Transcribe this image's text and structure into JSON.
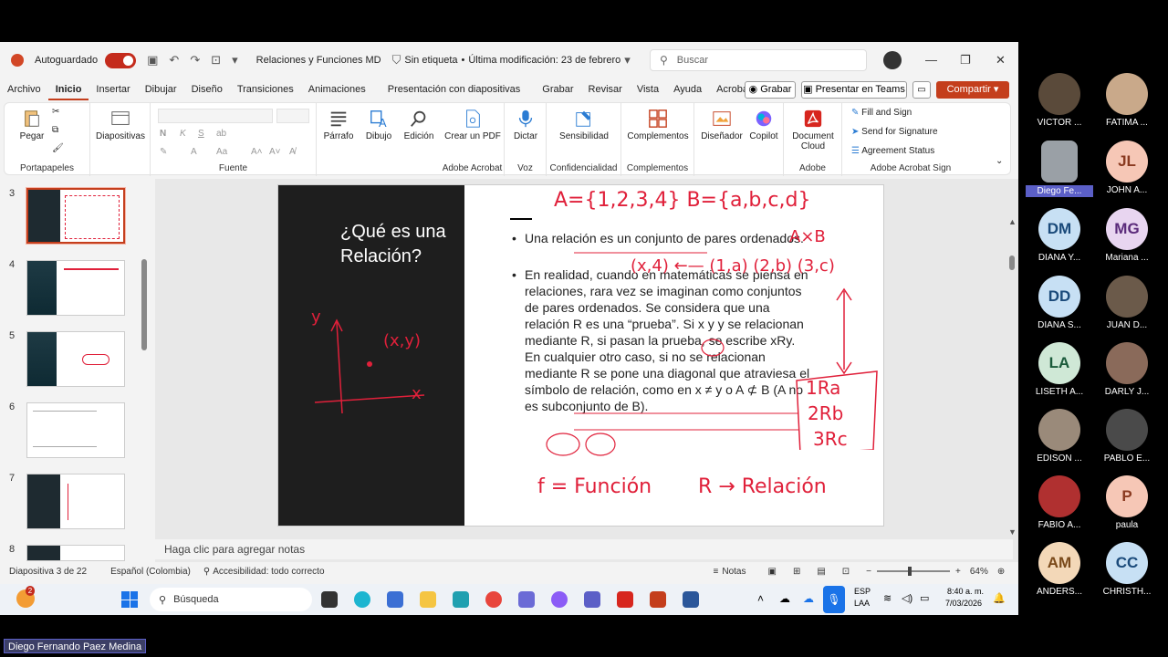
{
  "titlebar": {
    "autosave_label": "Autoguardado",
    "file_name": "Relaciones y Funciones MD",
    "label_status": "Sin etiqueta",
    "modified": "Última modificación: 23 de febrero",
    "search_placeholder": "Buscar"
  },
  "tabs": [
    "Archivo",
    "Inicio",
    "Insertar",
    "Dibujar",
    "Diseño",
    "Transiciones",
    "Animaciones",
    "Presentación con diapositivas",
    "Grabar",
    "Revisar",
    "Vista",
    "Ayuda",
    "Acrobat"
  ],
  "actions": {
    "grabar": "Grabar",
    "teams": "Presentar en Teams",
    "share": "Compartir"
  },
  "ribbon": {
    "paste": "Pegar",
    "slides": "Diapositivas",
    "paragraph": "Párrafo",
    "draw": "Dibujo",
    "edit": "Edición",
    "create_pdf": "Crear un PDF",
    "dictate": "Dictar",
    "sensitivity": "Sensibilidad",
    "addins": "Complementos",
    "designer": "Diseñador",
    "copilot": "Copilot",
    "doc_cloud": "Document Cloud",
    "fill_sign": "Fill and Sign",
    "send_sig": "Send for Signature",
    "agreement": "Agreement Status",
    "groups": {
      "clipboard": "Portapapeles",
      "font": "Fuente",
      "acrobat": "Adobe Acrobat",
      "voice": "Voz",
      "conf": "Confidencialidad",
      "addins": "Complementos",
      "adobe": "Adobe",
      "acrobat_sign": "Adobe Acrobat Sign"
    }
  },
  "thumbnails": [
    "3",
    "4",
    "5",
    "6",
    "7",
    "8"
  ],
  "slide": {
    "title": "¿Qué es una Relación?",
    "bullet1": "Una relación es un conjunto de pares ordenados.",
    "bullet2": "En realidad, cuando en matemáticas se piensa en relaciones, rara vez se imaginan como conjuntos de pares ordenados. Se considera que una relación R es una “prueba”. Si x y y se relacionan mediante R, si pasan la prueba, se escribe xRy. En cualquier otro caso, si no se relacionan mediante R se pone una diagonal que atraviesa el símbolo de relación, como en x ≠ y o A ⊄ B (A no es subconjunto de B).",
    "ink": {
      "sets": "A={1,2,3,4}  B={a,b,c,d}",
      "axb": "A×B",
      "pairs": "(x,4) ←— (1,a) (2,b) (3,c)",
      "r1": "1Ra",
      "r2": "2Rb",
      "r3": "3Rc",
      "f": "f = Función",
      "r": "R → Relación",
      "xy": "(x,y)",
      "yaxis": "y",
      "xaxis": "x"
    }
  },
  "notes_placeholder": "Haga clic para agregar notas",
  "status": {
    "slide": "Diapositiva 3 de 22",
    "lang": "Español (Colombia)",
    "access": "Accesibilidad: todo correcto",
    "notes": "Notas",
    "zoom": "64%"
  },
  "taskbar": {
    "search": "Búsqueda",
    "lang1": "ESP",
    "lang2": "LAA",
    "time": "8:40 a. m.",
    "date": "7/03/2026",
    "badge": "2"
  },
  "participants": [
    {
      "name": "VICTOR ...",
      "initials": "",
      "color": "#5a4a3a"
    },
    {
      "name": "FATIMA ...",
      "initials": "",
      "color": "#c9a98a"
    },
    {
      "name": "Diego Fe...",
      "initials": "",
      "color": "#9aa0a6"
    },
    {
      "name": "JOHN A...",
      "initials": "JL",
      "color": "#f6c7b6"
    },
    {
      "name": "DIANA Y...",
      "initials": "DM",
      "color": "#c7e0f4"
    },
    {
      "name": "Mariana ...",
      "initials": "MG",
      "color": "#e8d5f0"
    },
    {
      "name": "DIANA S...",
      "initials": "DD",
      "color": "#c7e0f4"
    },
    {
      "name": "JUAN D...",
      "initials": "",
      "color": "#6b5a4a"
    },
    {
      "name": "LISETH A...",
      "initials": "LA",
      "color": "#cfe8d6"
    },
    {
      "name": "DARLY J...",
      "initials": "",
      "color": "#8a6a5a"
    },
    {
      "name": "EDISON ...",
      "initials": "",
      "color": "#9a8a7a"
    },
    {
      "name": "PABLO E...",
      "initials": "",
      "color": "#4a4a4a"
    },
    {
      "name": "FABIO A...",
      "initials": "",
      "color": "#b03030"
    },
    {
      "name": "paula",
      "initials": "P",
      "color": "#f6c7b6"
    },
    {
      "name": "ANDERS...",
      "initials": "AM",
      "color": "#f3d8b8"
    },
    {
      "name": "CHRISTH...",
      "initials": "CC",
      "color": "#c7e0f4"
    }
  ],
  "presenter": "Diego Fernando Paez Medina"
}
